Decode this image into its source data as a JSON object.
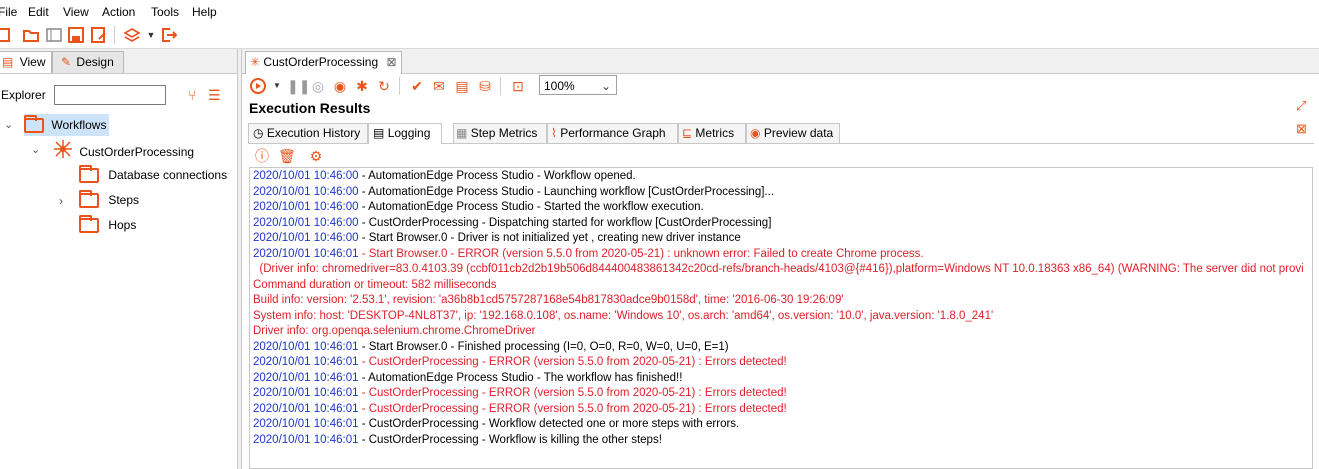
{
  "menubar": {
    "items": [
      "File",
      "Edit",
      "View",
      "Action",
      "Tools",
      "Help"
    ]
  },
  "toolbar": {
    "icons": [
      "new-file-icon",
      "open-folder-icon",
      "explorer-icon",
      "save-icon",
      "save-as-icon",
      "layers-icon",
      "dropdown-arrow-icon",
      "export-icon"
    ]
  },
  "left_panel": {
    "tabs": [
      {
        "label": "View",
        "icon": "view-icon"
      },
      {
        "label": "Design",
        "icon": "pencil-icon"
      }
    ],
    "explorer_label": "Explorer",
    "search_value": "",
    "tree": [
      {
        "label": "Workflows",
        "icon": "folder-icon",
        "expanded": true,
        "selected": true
      },
      {
        "label": "CustOrderProcessing",
        "icon": "workflow-icon",
        "expanded": true
      },
      {
        "label": "Database connections",
        "icon": "folder-icon"
      },
      {
        "label": "Steps",
        "icon": "folder-icon",
        "expandable": true
      },
      {
        "label": "Hops",
        "icon": "folder-icon"
      }
    ]
  },
  "editor": {
    "tab_label": "CustOrderProcessing",
    "zoom": "100%",
    "exec_title": "Execution Results",
    "result_tabs": [
      {
        "label": "Execution History",
        "icon": "clock-icon"
      },
      {
        "label": "Logging",
        "icon": "log-icon",
        "active": true
      },
      {
        "label": "Step Metrics",
        "icon": "grid-icon"
      },
      {
        "label": "Performance Graph",
        "icon": "graph-icon"
      },
      {
        "label": "Metrics",
        "icon": "metrics-icon"
      },
      {
        "label": "Preview data",
        "icon": "eye-icon"
      }
    ],
    "log": [
      {
        "ts": "2020/10/01 10:46:00",
        "msg": " - AutomationEdge Process Studio - Workflow opened.",
        "error": false
      },
      {
        "ts": "2020/10/01 10:46:00",
        "msg": " - AutomationEdge Process Studio - Launching workflow [CustOrderProcessing]...",
        "error": false
      },
      {
        "ts": "2020/10/01 10:46:00",
        "msg": " - AutomationEdge Process Studio - Started the workflow execution.",
        "error": false
      },
      {
        "ts": "2020/10/01 10:46:00",
        "msg": " - CustOrderProcessing - Dispatching started for workflow [CustOrderProcessing]",
        "error": false
      },
      {
        "ts": "2020/10/01 10:46:00",
        "msg": " - Start Browser.0 - Driver is not initialized yet , creating new driver instance",
        "error": false
      },
      {
        "ts": "2020/10/01 10:46:01",
        "msg": " - Start Browser.0 - ERROR (version 5.5.0 from 2020-05-21) : unknown error: Failed to create Chrome process.",
        "error": true
      },
      {
        "ts": "",
        "msg": "  (Driver info: chromedriver=83.0.4103.39 (ccbf011cb2d2b19b506d844400483861342c20cd-refs/branch-heads/4103@{#416}),platform=Windows NT 10.0.18363 x86_64) (WARNING: The server did not provi",
        "error": true
      },
      {
        "ts": "",
        "msg": "Command duration or timeout: 582 milliseconds",
        "error": true
      },
      {
        "ts": "",
        "msg": "Build info: version: '2.53.1', revision: 'a36b8b1cd5757287168e54b817830adce9b0158d', time: '2016-06-30 19:26:09'",
        "error": true
      },
      {
        "ts": "",
        "msg": "System info: host: 'DESKTOP-4NL8T37', ip: '192.168.0.108', os.name: 'Windows 10', os.arch: 'amd64', os.version: '10.0', java.version: '1.8.0_241'",
        "error": true
      },
      {
        "ts": "",
        "msg": "Driver info: org.openqa.selenium.chrome.ChromeDriver",
        "error": true
      },
      {
        "ts": "2020/10/01 10:46:01",
        "msg": " - Start Browser.0 - Finished processing (I=0, O=0, R=0, W=0, U=0, E=1)",
        "error": false
      },
      {
        "ts": "2020/10/01 10:46:01",
        "msg": " - CustOrderProcessing - ERROR (version 5.5.0 from 2020-05-21) : Errors detected!",
        "error": true
      },
      {
        "ts": "2020/10/01 10:46:01",
        "msg": " - AutomationEdge Process Studio - The workflow has finished!!",
        "error": false
      },
      {
        "ts": "2020/10/01 10:46:01",
        "msg": " - CustOrderProcessing - ERROR (version 5.5.0 from 2020-05-21) : Errors detected!",
        "error": true
      },
      {
        "ts": "2020/10/01 10:46:01",
        "msg": " - CustOrderProcessing - ERROR (version 5.5.0 from 2020-05-21) : Errors detected!",
        "error": true
      },
      {
        "ts": "2020/10/01 10:46:01",
        "msg": " - CustOrderProcessing - Workflow detected one or more steps with errors.",
        "error": false
      },
      {
        "ts": "2020/10/01 10:46:01",
        "msg": " - CustOrderProcessing - Workflow is killing the other steps!",
        "error": false
      }
    ]
  },
  "colors": {
    "accent": "#e8541b",
    "timestamp": "#1f35c9",
    "error": "#e0202a",
    "selection": "#cde3f7"
  }
}
